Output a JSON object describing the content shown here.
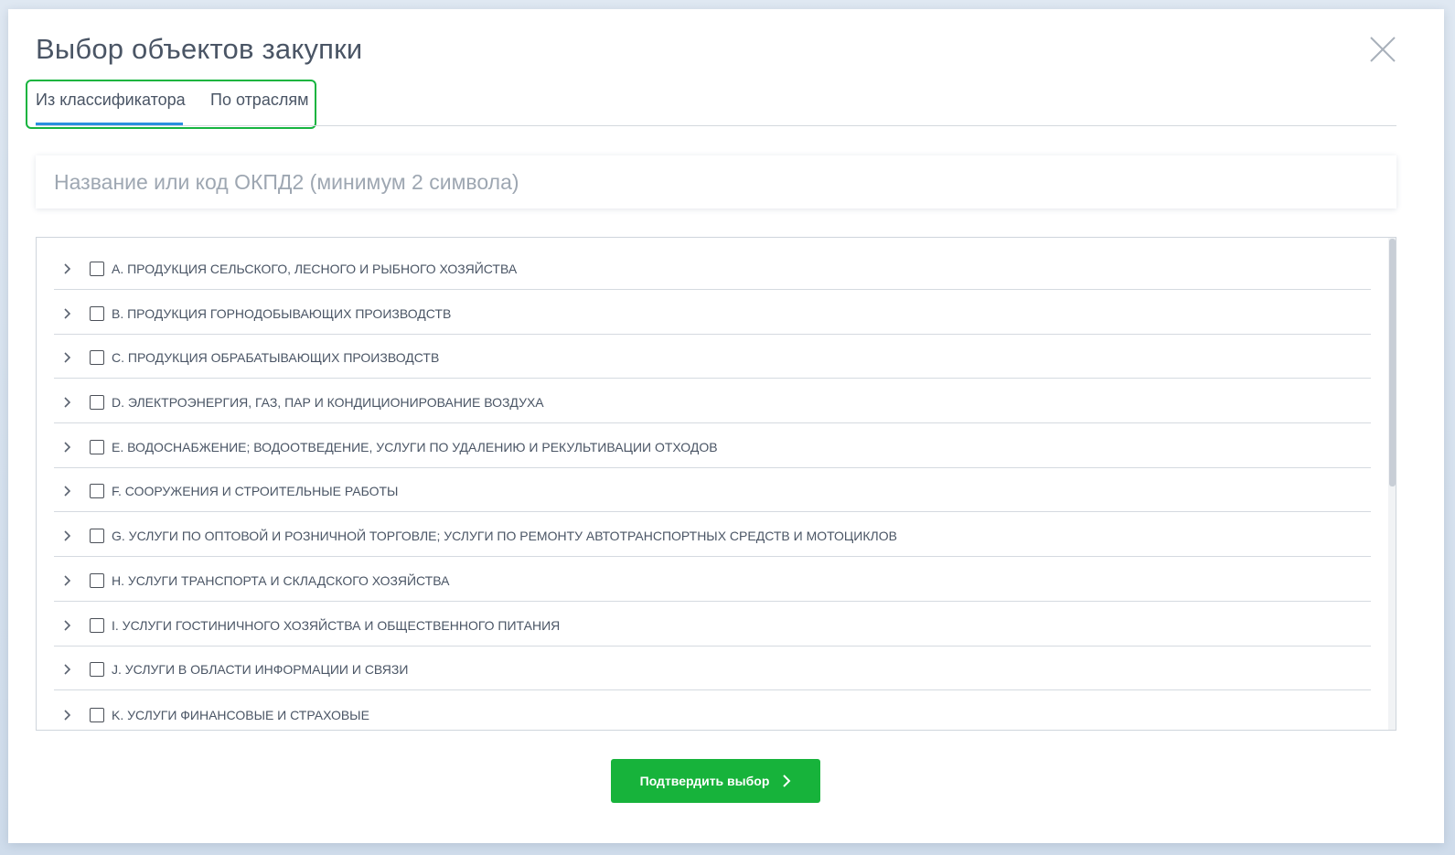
{
  "modal": {
    "title": "Выбор объектов закупки"
  },
  "tabs": [
    {
      "label": "Из классификатора",
      "active": true
    },
    {
      "label": "По отраслям",
      "active": false
    }
  ],
  "search": {
    "placeholder": "Название или код ОКПД2 (минимум 2 символа)",
    "value": ""
  },
  "tree": {
    "items": [
      {
        "label": "A. ПРОДУКЦИЯ СЕЛЬСКОГО, ЛЕСНОГО И РЫБНОГО ХОЗЯЙСТВА",
        "checked": false
      },
      {
        "label": "B. ПРОДУКЦИЯ ГОРНОДОБЫВАЮЩИХ ПРОИЗВОДСТВ",
        "checked": false
      },
      {
        "label": "C. ПРОДУКЦИЯ ОБРАБАТЫВАЮЩИХ ПРОИЗВОДСТВ",
        "checked": false
      },
      {
        "label": "D. ЭЛЕКТРОЭНЕРГИЯ, ГАЗ, ПАР И КОНДИЦИОНИРОВАНИЕ ВОЗДУХА",
        "checked": false
      },
      {
        "label": "E. ВОДОСНАБЖЕНИЕ; ВОДООТВЕДЕНИЕ, УСЛУГИ ПО УДАЛЕНИЮ И РЕКУЛЬТИВАЦИИ ОТХОДОВ",
        "checked": false
      },
      {
        "label": "F. СООРУЖЕНИЯ И СТРОИТЕЛЬНЫЕ РАБОТЫ",
        "checked": false
      },
      {
        "label": "G. УСЛУГИ ПО ОПТОВОЙ И РОЗНИЧНОЙ ТОРГОВЛЕ; УСЛУГИ ПО РЕМОНТУ АВТОТРАНСПОРТНЫХ СРЕДСТВ И МОТОЦИКЛОВ",
        "checked": false
      },
      {
        "label": "H. УСЛУГИ ТРАНСПОРТА И СКЛАДСКОГО ХОЗЯЙСТВА",
        "checked": false
      },
      {
        "label": "I. УСЛУГИ ГОСТИНИЧНОГО ХОЗЯЙСТВА И ОБЩЕСТВЕННОГО ПИТАНИЯ",
        "checked": false
      },
      {
        "label": "J. УСЛУГИ В ОБЛАСТИ ИНФОРМАЦИИ И СВЯЗИ",
        "checked": false
      },
      {
        "label": "K. УСЛУГИ ФИНАНСОВЫЕ И СТРАХОВЫЕ",
        "checked": false
      }
    ]
  },
  "footer": {
    "confirm_label": "Подтвердить выбор"
  },
  "colors": {
    "accent_green": "#17b33b",
    "tab_underline": "#2a8fde",
    "highlight_border": "#16b43f",
    "text": "#4a5565"
  },
  "icons": {
    "close": "close-icon",
    "expand": "chevron-right-icon",
    "button_arrow": "chevron-right-icon"
  }
}
